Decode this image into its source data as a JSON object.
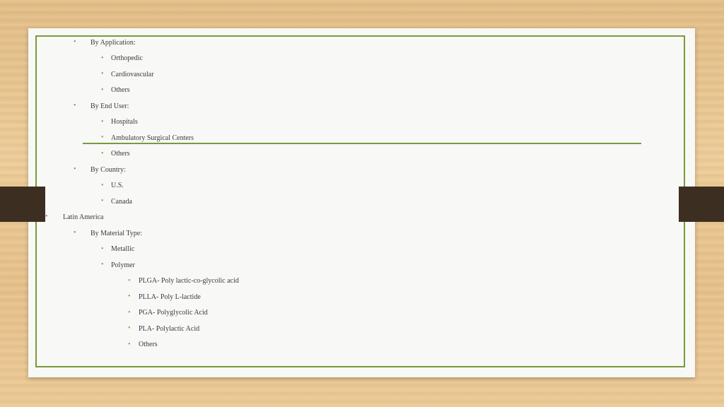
{
  "outline": {
    "by_application": "By Application:",
    "orthopedic": "Orthopedic",
    "cardiovascular": "Cardiovascular",
    "others_1": "Others",
    "by_end_user": "By End User:",
    "hospitals": "Hospitals",
    "ambulatory": "Ambulatory Surgical Centers",
    "others_2": "Others",
    "by_country": "By Country:",
    "us": "U.S.",
    "canada": "Canada",
    "latin_america": "Latin America",
    "by_material_type": "By Material Type:",
    "metallic": "Metallic",
    "polymer": "Polymer",
    "plga": "PLGA- Poly lactic-co-glycolic acid",
    "plla": "PLLA- Poly L-lactide",
    "pga": "PGA- Polyglycolic Acid",
    "pla": "PLA- Polylactic Acid",
    "others_3": "Others"
  },
  "bullet_char": "•",
  "colors": {
    "frame": "#7a9a3a",
    "bullet_green": "#8aa84a",
    "tab": "#3c2f22"
  }
}
